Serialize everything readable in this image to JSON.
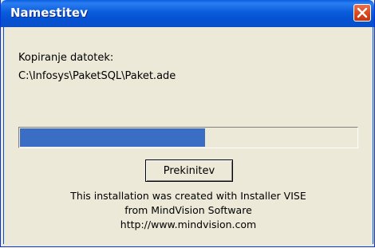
{
  "window": {
    "title": "Namestitev"
  },
  "status": {
    "action_label": "Kopiranje datotek:",
    "file_path": "C:\\Infosys\\PaketSQL\\Paket.ade"
  },
  "progress": {
    "fraction": 0.55,
    "fill_color": "#3a6ec4"
  },
  "buttons": {
    "cancel_label": "Prekinitev"
  },
  "footer": {
    "line1": "This installation was created with Installer VISE",
    "line2": "from MindVision Software",
    "line3": "http://www.mindvision.com"
  },
  "colors": {
    "titlebar": "#0a5ddb",
    "close_button": "#d9491f",
    "dialog_background": "#ece9d8"
  },
  "icons": {
    "close": "close-icon"
  }
}
